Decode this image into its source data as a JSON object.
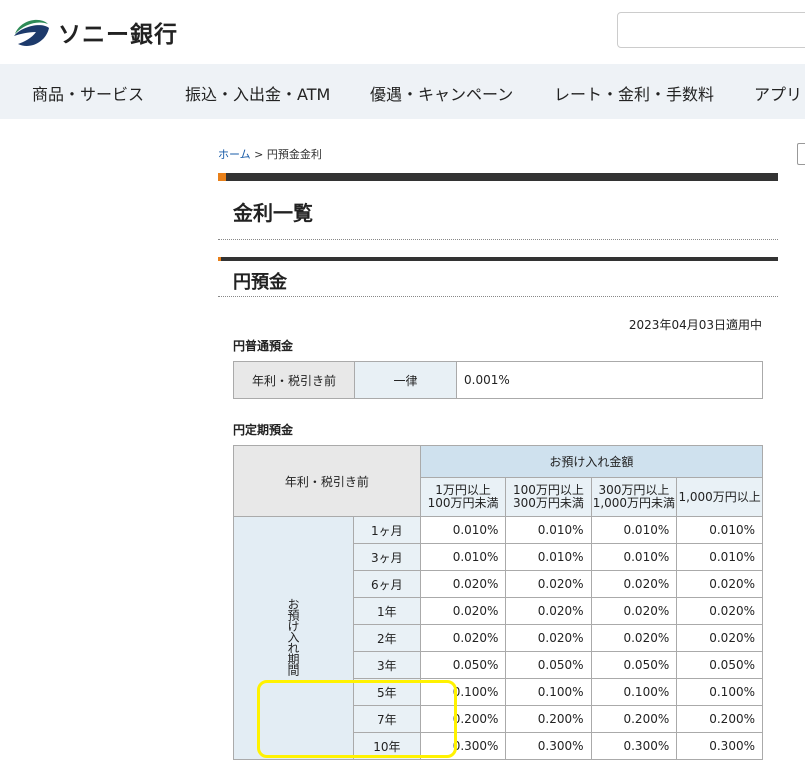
{
  "header": {
    "logo_text": "ソニー銀行",
    "colors": {
      "logo_green": "#2e8b57",
      "logo_navy": "#1d3a6b"
    }
  },
  "gnav": {
    "items": [
      "商品・サービス",
      "振込・入出金・ATM",
      "優遇・キャンペーン",
      "レート・金利・手数料",
      "アプリ"
    ]
  },
  "breadcrumb": {
    "home": "ホーム",
    "sep": ">",
    "current": "円預金金利"
  },
  "page_title": "金利一覧",
  "section_title": "円預金",
  "date": "2023年04月03日適用中",
  "ordinary": {
    "title": "円普通預金",
    "label": "年利・税引き前",
    "type": "一律",
    "rate": "0.001%"
  },
  "fixed": {
    "title": "円定期預金",
    "corner": "年利・税引き前",
    "amount_header": "お預け入れ金額",
    "period_label": "お預け入れ期間",
    "columns": [
      {
        "line1": "1万円以上",
        "line2": "100万円未満"
      },
      {
        "line1": "100万円以上",
        "line2": "300万円未満"
      },
      {
        "line1": "300万円以上",
        "line2": "1,000万円未満"
      },
      {
        "line1": "1,000万円以上",
        "line2": ""
      }
    ],
    "rows": [
      {
        "term": "1ヶ月",
        "rates": [
          "0.010%",
          "0.010%",
          "0.010%",
          "0.010%"
        ]
      },
      {
        "term": "3ヶ月",
        "rates": [
          "0.010%",
          "0.010%",
          "0.010%",
          "0.010%"
        ]
      },
      {
        "term": "6ヶ月",
        "rates": [
          "0.020%",
          "0.020%",
          "0.020%",
          "0.020%"
        ]
      },
      {
        "term": "1年",
        "rates": [
          "0.020%",
          "0.020%",
          "0.020%",
          "0.020%"
        ]
      },
      {
        "term": "2年",
        "rates": [
          "0.020%",
          "0.020%",
          "0.020%",
          "0.020%"
        ]
      },
      {
        "term": "3年",
        "rates": [
          "0.050%",
          "0.050%",
          "0.050%",
          "0.050%"
        ]
      },
      {
        "term": "5年",
        "rates": [
          "0.100%",
          "0.100%",
          "0.100%",
          "0.100%"
        ]
      },
      {
        "term": "7年",
        "rates": [
          "0.200%",
          "0.200%",
          "0.200%",
          "0.200%"
        ]
      },
      {
        "term": "10年",
        "rates": [
          "0.300%",
          "0.300%",
          "0.300%",
          "0.300%"
        ]
      }
    ],
    "highlight_color": "#fff200"
  }
}
